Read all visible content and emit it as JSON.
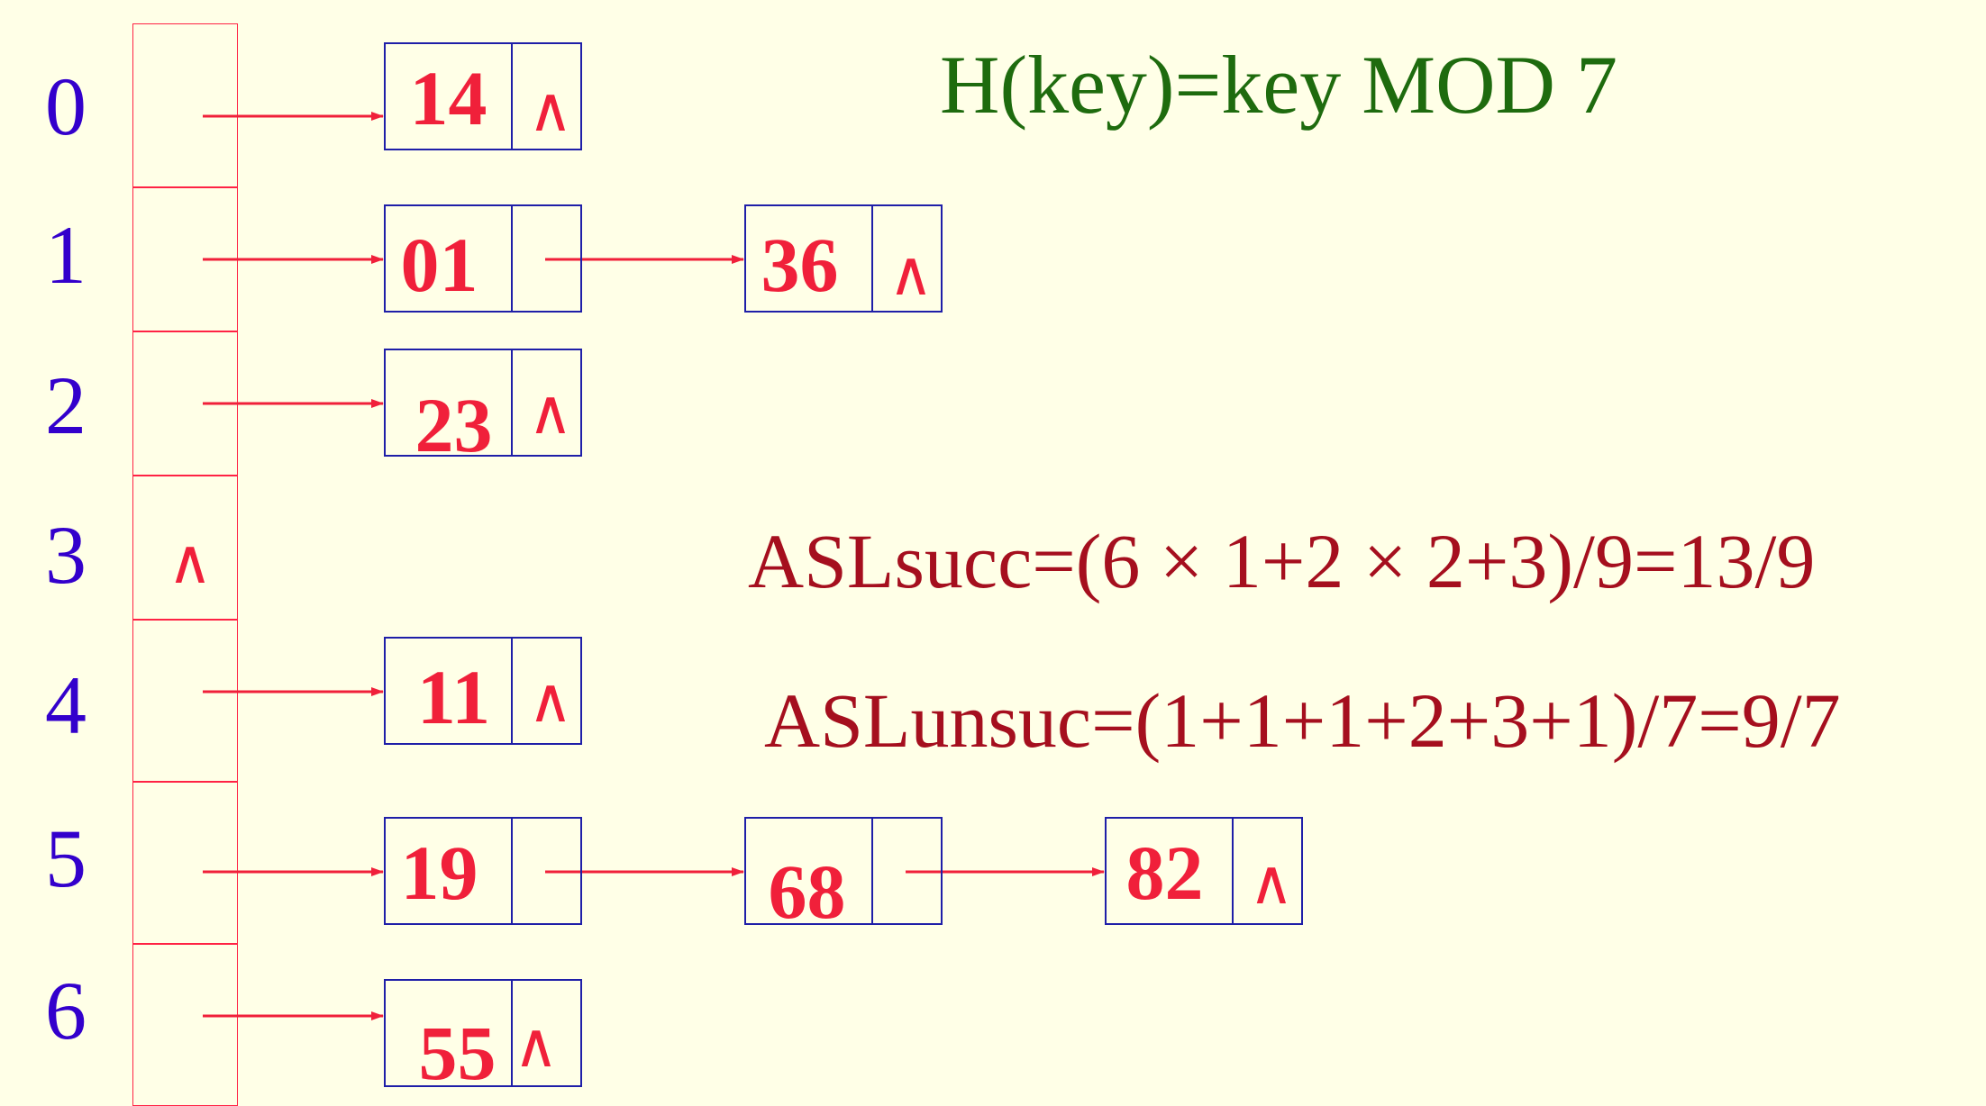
{
  "title": "H(key)=key MOD 7",
  "asl_succ": "ASLsucc=(6 × 1+2 × 2+3)/9=13/9",
  "asl_unsucc": "ASLunsuc=(1+1+1+2+3+1)/7=9/7",
  "null_symbol": "∧",
  "buckets": [
    {
      "index": "0",
      "nodes": [
        "14"
      ]
    },
    {
      "index": "1",
      "nodes": [
        "01",
        "36"
      ]
    },
    {
      "index": "2",
      "nodes": [
        "23"
      ]
    },
    {
      "index": "3",
      "nodes": []
    },
    {
      "index": "4",
      "nodes": [
        "11"
      ]
    },
    {
      "index": "5",
      "nodes": [
        "19",
        "68",
        "82"
      ]
    },
    {
      "index": "6",
      "nodes": [
        "55"
      ]
    }
  ],
  "colors": {
    "background": "#FFFFE7",
    "index_text": "#3300CC",
    "node_value": "#F0203A",
    "node_border": "#1F1FA8",
    "arrow": "#F0203A",
    "title": "#1E6B0E",
    "formula": "#A50F1E"
  }
}
